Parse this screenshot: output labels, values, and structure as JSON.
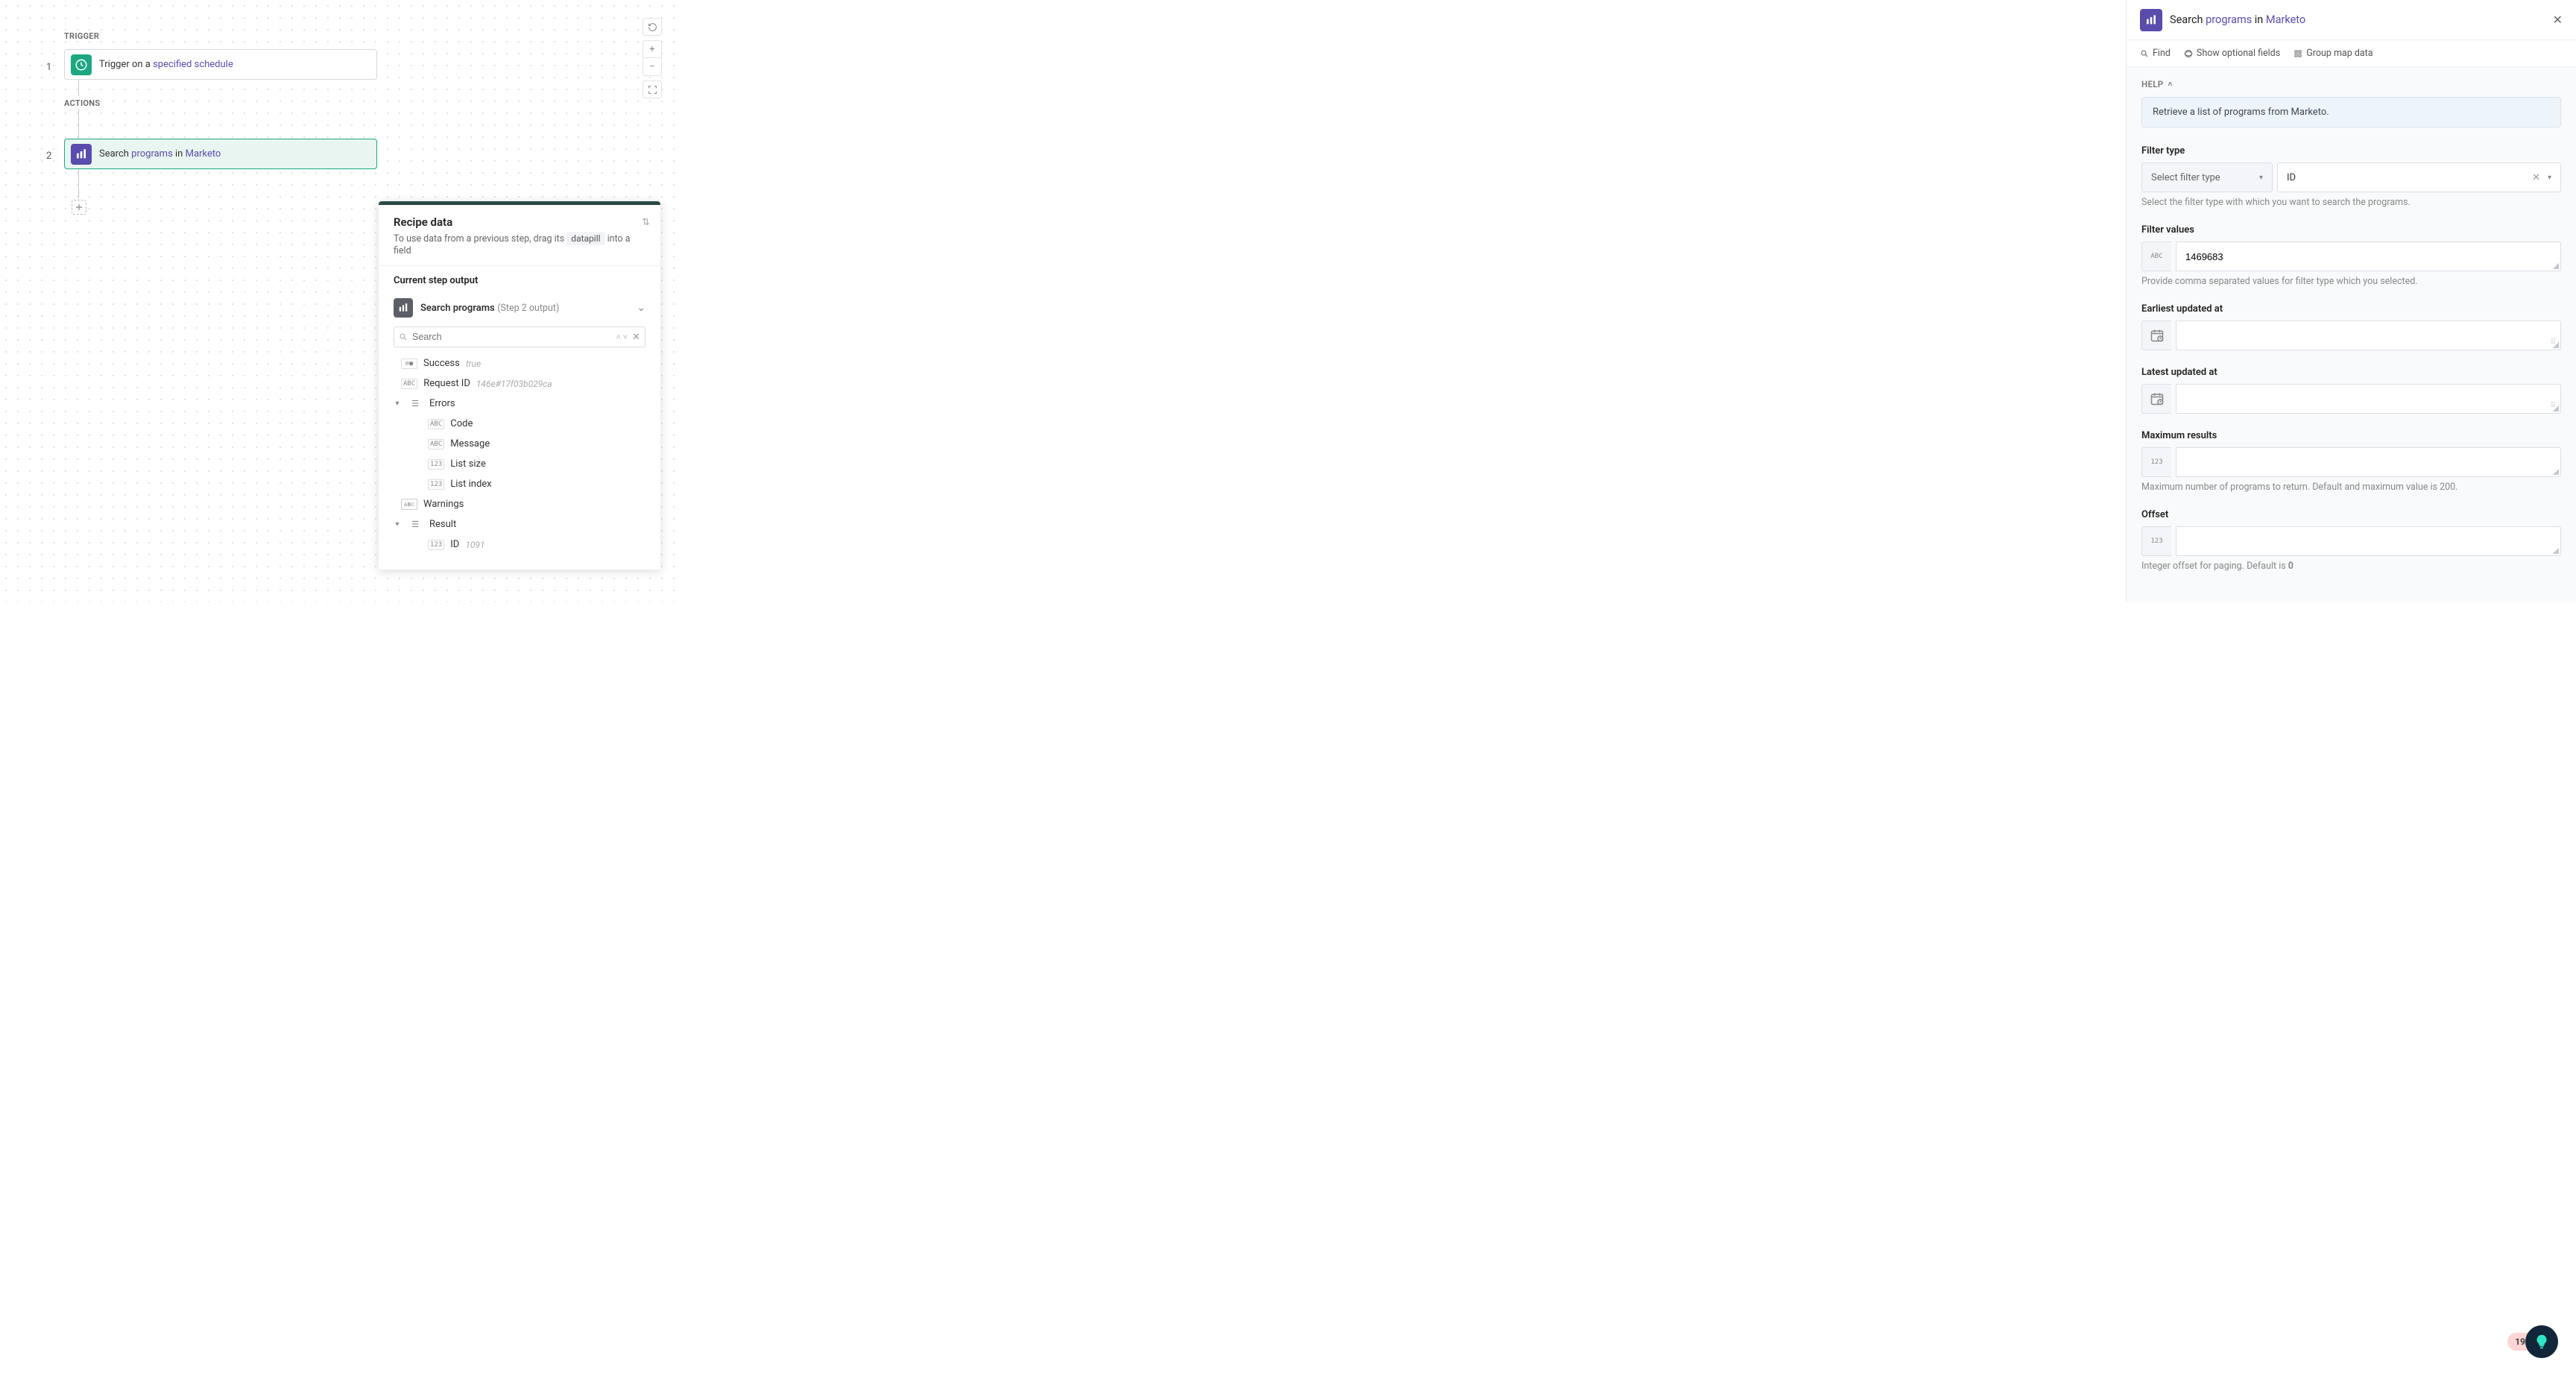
{
  "canvas": {
    "trigger_label": "TRIGGER",
    "actions_label": "ACTIONS",
    "step1_num": "1",
    "step2_num": "2",
    "step1_prefix": "Trigger on a ",
    "step1_hl": "specified schedule",
    "step2_prefix": "Search ",
    "step2_hl1": "programs",
    "step2_mid": " in ",
    "step2_hl2": "Marketo"
  },
  "recipe_data": {
    "title": "Recipe data",
    "subtitle_pre": "To use data from a previous step, drag its ",
    "subtitle_pill": "datapill",
    "subtitle_post": " into a field",
    "current_label": "Current step output",
    "source_name": "Search programs",
    "source_sub": "(Step 2 output)",
    "search_placeholder": "Search",
    "rows": {
      "success": {
        "name": "Success",
        "val": "true"
      },
      "request": {
        "name": "Request ID",
        "val": "146e#17f03b029ca"
      },
      "errors": "Errors",
      "code": "Code",
      "message": "Message",
      "listsize": "List size",
      "listindex": "List index",
      "warnings": "Warnings",
      "result": "Result",
      "id": {
        "name": "ID",
        "val": "1091"
      }
    }
  },
  "config": {
    "title_pre": "Search ",
    "title_hl1": "programs",
    "title_mid": " in ",
    "title_hl2": "Marketo",
    "toolbar": {
      "find": "Find",
      "optional": "Show optional fields",
      "group": "Group map data"
    },
    "help_label": "HELP",
    "help_text": "Retrieve a list of programs from Marketo.",
    "filter_type": {
      "label": "Filter type",
      "placeholder": "Select filter type",
      "value": "ID",
      "desc": "Select the filter type with which you want to search the programs."
    },
    "filter_values": {
      "label": "Filter values",
      "value": "1469683",
      "desc": "Provide comma separated values for filter type which you selected."
    },
    "earliest": {
      "label": "Earliest updated at"
    },
    "latest": {
      "label": "Latest updated at"
    },
    "max": {
      "label": "Maximum results",
      "desc": "Maximum number of programs to return. Default and maximum value is 200."
    },
    "offset": {
      "label": "Offset",
      "desc_pre": "Integer offset for paging. Default is ",
      "desc_bold": "0"
    }
  },
  "assistant_count": "19"
}
